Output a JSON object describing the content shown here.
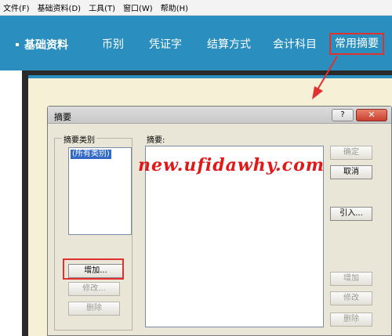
{
  "menubar": {
    "items": [
      "文件(F)",
      "基础资料(D)",
      "工具(T)",
      "窗口(W)",
      "帮助(H)"
    ]
  },
  "ribbon": {
    "title": "基础资料",
    "nav": [
      "币别",
      "凭证字",
      "结算方式",
      "会计科目",
      "常用摘要"
    ],
    "active_index": 4
  },
  "dialog": {
    "title": "摘要",
    "help_label": "?",
    "close_label": "✕",
    "category_group_label": "摘要类别",
    "category_list": [
      "(所有类别)"
    ],
    "category_buttons": {
      "add": "增加...",
      "modify": "修改...",
      "delete": "删除"
    },
    "summary_label": "摘要:",
    "buttons": {
      "ok": "确定",
      "cancel": "取消",
      "import": "引入...",
      "add": "增加",
      "modify": "修改",
      "delete": "删除"
    }
  },
  "watermark": "new.ufidawhy.com",
  "colors": {
    "ribbon": "#2a8fbe",
    "highlight": "#e03030",
    "watermark": "#e01818",
    "cream": "#f6f0d6",
    "selection": "#3168c6"
  }
}
